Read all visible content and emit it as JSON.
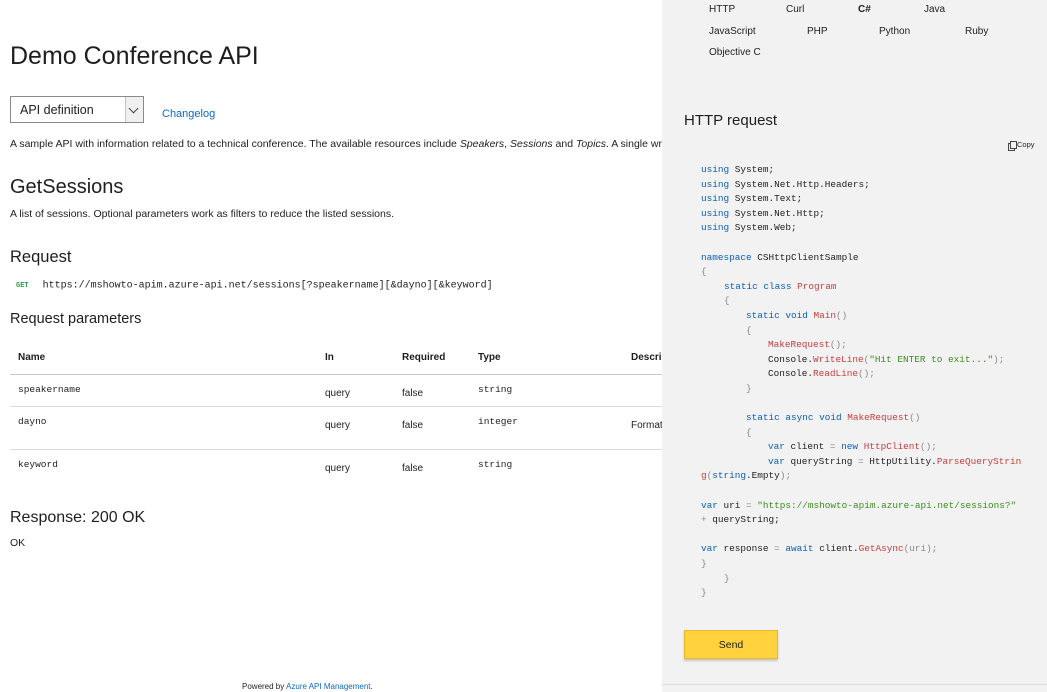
{
  "api": {
    "title": "Demo Conference API",
    "selector_value": "API definition",
    "changelog_label": "Changelog",
    "description": {
      "prefix": "A sample API with information related to a technical conference. The available resources include ",
      "res1": "Speakers",
      "sep1": ", ",
      "res2": "Sessions",
      "sep2": " and ",
      "res3": "Topics",
      "suffix": ". A single write ope"
    }
  },
  "operation": {
    "title": "GetSessions",
    "description": "A list of sessions. Optional parameters work as filters to reduce the listed sessions."
  },
  "request": {
    "heading": "Request",
    "method": "GET",
    "url": "https://mshowto-apim.azure-api.net/sessions[?speakername][&dayno][&keyword]"
  },
  "parameters": {
    "heading": "Request parameters",
    "columns": [
      "Name",
      "In",
      "Required",
      "Type",
      "Descri"
    ],
    "rows": [
      {
        "name": "speakername",
        "in": "query",
        "required": "false",
        "type": "string",
        "description": ""
      },
      {
        "name": "dayno",
        "in": "query",
        "required": "false",
        "type": "integer",
        "description": "Format"
      },
      {
        "name": "keyword",
        "in": "query",
        "required": "false",
        "type": "string",
        "description": ""
      }
    ]
  },
  "response": {
    "heading": "Response: 200 OK",
    "description": "OK"
  },
  "footer": {
    "prefix": "Powered by ",
    "link": "Azure API Management",
    "suffix": "."
  },
  "console": {
    "languages": [
      "HTTP",
      "Curl",
      "C#",
      "Java",
      "JavaScript",
      "PHP",
      "Python",
      "Ruby",
      "Objective C"
    ],
    "active_language": "C#",
    "heading": "HTTP request",
    "copy_label": "Copy",
    "send_label": "Send",
    "code": {
      "u1_k": "using",
      "u1": " System;",
      "u2_k": "using",
      "u2": " System.Net.Http.Headers;",
      "u3_k": "using",
      "u3": " System.Text;",
      "u4_k": "using",
      "u4": " System.Net.Http;",
      "u5_k": "using",
      "u5": " System.Web;",
      "ns_k": "namespace",
      "ns": " CSHttpClientSample",
      "ob1": "{",
      "cls_k": "static class",
      "cls_t": "Program",
      "ob2": "{",
      "main_k": "static void",
      "main_t": "Main",
      "main_p": "()",
      "ob3": "{",
      "mr_t": "MakeRequest",
      "mr_p": "();",
      "wl_a": "Console.",
      "wl_t": "WriteLine",
      "wl_p1": "(",
      "wl_s": "\"Hit ENTER to exit...\"",
      "wl_p2": ");",
      "rl_a": "Console.",
      "rl_t": "ReadLine",
      "rl_p": "();",
      "cb3": "}",
      "async_k": "static async void",
      "async_t": "MakeRequest",
      "async_p": "()",
      "ob4": "{",
      "cli_k": "var",
      "cli_a": " client ",
      "cli_eq": "=",
      "cli_k2": " new ",
      "cli_t": "HttpClient",
      "cli_p": "();",
      "qs_k": "var",
      "qs_a": " queryString ",
      "qs_eq": "=",
      "qs_b": " HttpUtility.",
      "qs_t": "ParseQueryStrin",
      "qs2_t": "g",
      "qs2_p1": "(",
      "qs2_k": "string",
      "qs2_a": ".Empty",
      "qs2_p2": ");",
      "uri_k": "var",
      "uri_a": " uri ",
      "uri_eq": "=",
      "uri_s": " \"https://mshowto-apim.azure-api.net/sessions?\"",
      "plus": "+",
      "plus_a": " queryString;",
      "rsp_k": "var",
      "rsp_a": " response ",
      "rsp_eq": "=",
      "rsp_k2": " await",
      "rsp_b": " client.",
      "rsp_t": "GetAsync",
      "rsp_p": "(uri);",
      "cb4": "}",
      "cb2": "}",
      "cb1": "}"
    }
  }
}
